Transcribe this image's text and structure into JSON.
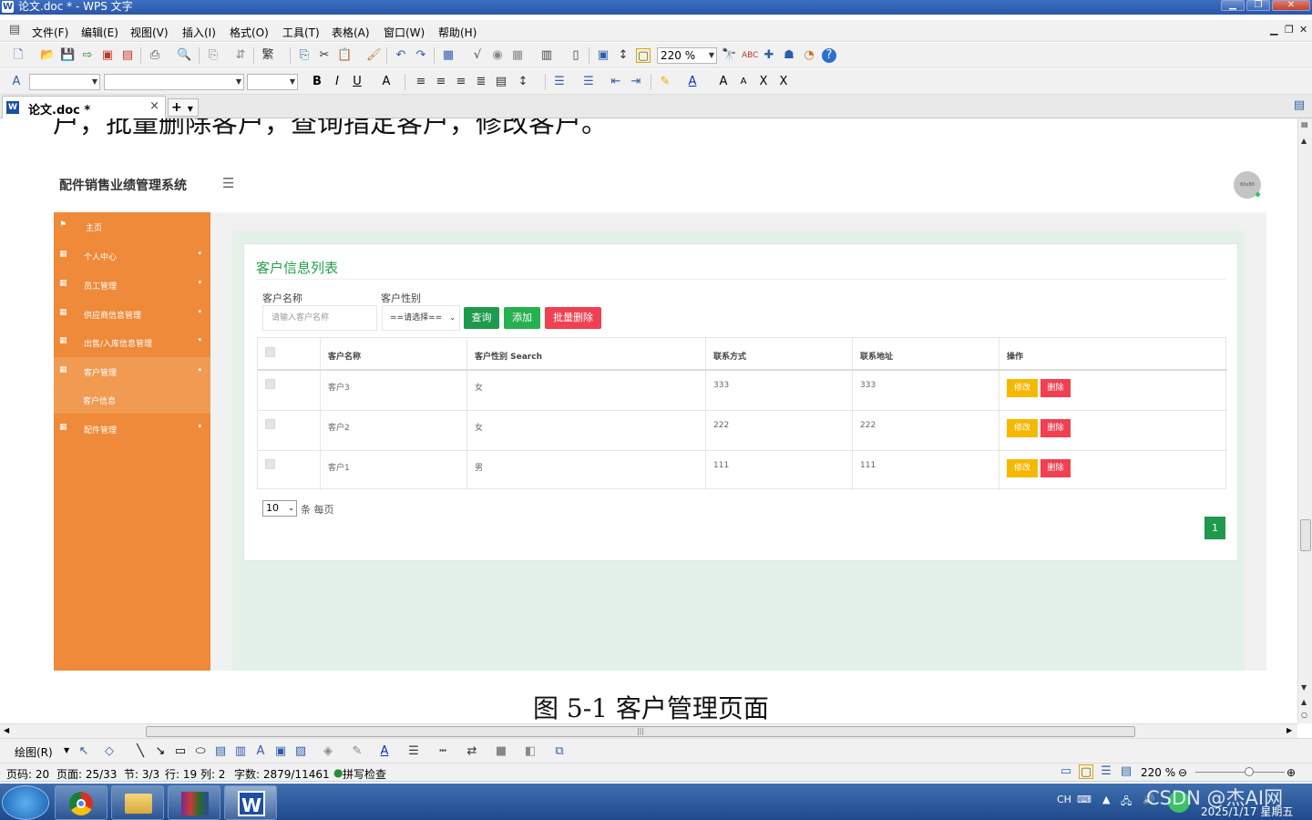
{
  "window": {
    "title": "论文.doc * - WPS 文字",
    "app_icon": "W"
  },
  "menu": {
    "items": [
      "文件(F)",
      "编辑(E)",
      "视图(V)",
      "插入(I)",
      "格式(O)",
      "工具(T)",
      "表格(A)",
      "窗口(W)",
      "帮助(H)"
    ]
  },
  "toolbar": {
    "zoom": "220 %"
  },
  "tab": {
    "name": "论文.doc *",
    "close": "×",
    "new": "+"
  },
  "document": {
    "cut_text": "户，批量删除客户，查询指定客户，修改客户。",
    "caption": "图 5-1  客户管理页面",
    "app": {
      "title": "配件销售业绩管理系统",
      "avatar_text": "80x80",
      "sidebar": [
        {
          "label": "主页",
          "icon": "⚑",
          "caret": ""
        },
        {
          "label": "个人中心",
          "icon": "▦",
          "caret": "▾"
        },
        {
          "label": "员工管理",
          "icon": "▦",
          "caret": "▾"
        },
        {
          "label": "供应商信息管理",
          "icon": "▦",
          "caret": "▾"
        },
        {
          "label": "出售/入库信息管理",
          "icon": "▦",
          "caret": "▾"
        },
        {
          "label": "客户管理",
          "icon": "▦",
          "caret": "▴"
        },
        {
          "label": "客户信息",
          "icon": "",
          "caret": ""
        },
        {
          "label": "配件管理",
          "icon": "▦",
          "caret": "▾"
        }
      ],
      "page_title": "客户信息列表",
      "filters": {
        "name_label": "客户名称",
        "name_placeholder": "请输入客户名称",
        "sex_label": "客户性别",
        "sex_value": "==请选择=="
      },
      "buttons": {
        "query": "查询",
        "add": "添加",
        "batch_delete": "批量删除"
      },
      "table": {
        "headers": [
          "客户名称",
          "客户性别 Search",
          "联系方式",
          "联系地址",
          "操作"
        ],
        "rows": [
          {
            "name": "客户3",
            "sex": "女",
            "phone": "333",
            "address": "333"
          },
          {
            "name": "客户2",
            "sex": "女",
            "phone": "222",
            "address": "222"
          },
          {
            "name": "客户1",
            "sex": "男",
            "phone": "111",
            "address": "111"
          }
        ],
        "edit_label": "修改",
        "delete_label": "删除"
      },
      "pagination": {
        "page_size": "10",
        "per_page_label": "条 每页",
        "current_page": "1"
      }
    }
  },
  "drawbar": {
    "label": "绘图(R)"
  },
  "status": {
    "page_num": "页码: 20",
    "pages": "页面: 25/33",
    "section": "节: 3/3",
    "line_col": "行: 19  列: 2",
    "words": "字数: 2879/11461",
    "spell": "拼写检查",
    "zoom": "220 %"
  },
  "taskbar": {
    "lang": "CH",
    "watermark": "CSDN @杰AI网",
    "date": "2025/1/17 星期五"
  }
}
